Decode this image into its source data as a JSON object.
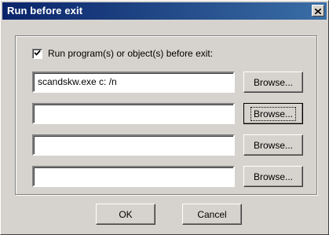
{
  "window": {
    "title": "Run before exit",
    "close_glyph": "×"
  },
  "options": {
    "run_before_exit_checked": true,
    "run_before_exit_label": "Run program(s) or object(s) before exit:"
  },
  "programs": [
    {
      "value": "scandskw.exe c: /n",
      "browse_label": "Browse..."
    },
    {
      "value": "",
      "browse_label": "Browse..."
    },
    {
      "value": "",
      "browse_label": "Browse..."
    },
    {
      "value": "",
      "browse_label": "Browse..."
    }
  ],
  "buttons": {
    "ok_label": "OK",
    "cancel_label": "Cancel"
  },
  "colors": {
    "title_bar_start": "#0a246a",
    "title_bar_end": "#3a6ea5",
    "dialog_face": "#d6d3ce"
  },
  "icons": {
    "close": "close-icon",
    "check": "checkmark-icon"
  }
}
